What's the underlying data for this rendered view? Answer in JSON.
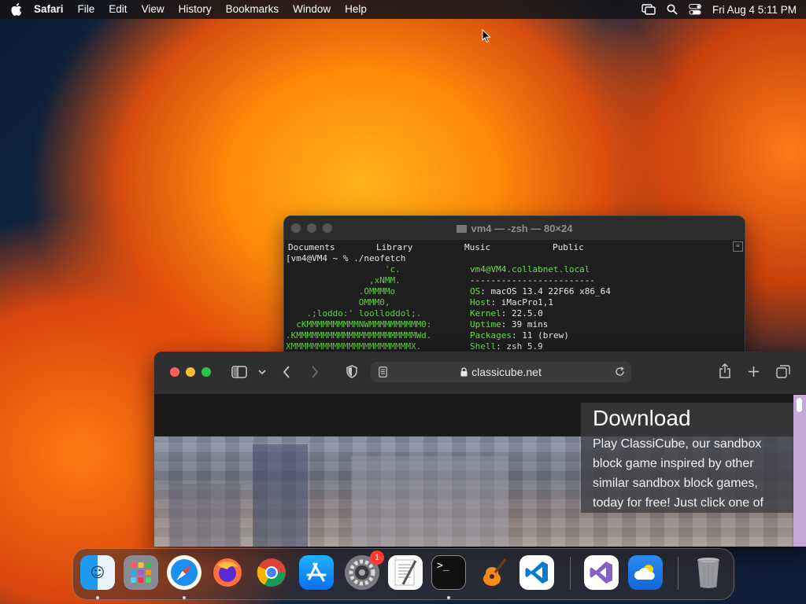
{
  "menubar": {
    "app_name": "Safari",
    "items": [
      "File",
      "Edit",
      "View",
      "History",
      "Bookmarks",
      "Window",
      "Help"
    ],
    "clock": "Fri Aug 4  5:11 PM"
  },
  "terminal": {
    "title": "vm4 — -zsh — 80×24",
    "dirs": [
      "Documents",
      "Library",
      "Music",
      "Public"
    ],
    "prompt": "vm4@VM4 ~ % ./neofetch",
    "logo_lines": [
      "                   'c.",
      "                ,xNMM.",
      "              .OMMMMo",
      "              OMMM0,",
      "    .;loddo:' loolloddol;.",
      "  cKMMMMMMMMMMNWMMMMMMMMMM0:",
      ".KMMMMMMMMMMMMMMMMMMMMMMMWd.",
      "XMMMMMMMMMMMMMMMMMMMMMMMX."
    ],
    "user_host": "vm4@VM4.collabnet.local",
    "separator": "------------------------",
    "info": [
      {
        "key": "OS",
        "value": "macOS 13.4 22F66 x86_64"
      },
      {
        "key": "Host",
        "value": "iMacPro1,1"
      },
      {
        "key": "Kernel",
        "value": "22.5.0"
      },
      {
        "key": "Uptime",
        "value": "39 mins"
      },
      {
        "key": "Packages",
        "value": "11 (brew)"
      },
      {
        "key": "Shell",
        "value": "zsh 5.9"
      }
    ]
  },
  "safari": {
    "url": "classicube.net",
    "panel_title": "Download",
    "panel_text": "Play ClassiCube, our sandbox block game inspired by other similar sandbox block games, today for free! Just click one of"
  },
  "dock": {
    "apps": [
      {
        "name": "Finder",
        "icon": "finder-icon",
        "running": true
      },
      {
        "name": "Launchpad",
        "icon": "launchpad-icon",
        "running": false
      },
      {
        "name": "Safari",
        "icon": "safari-icon",
        "running": true
      },
      {
        "name": "Firefox",
        "icon": "firefox-icon",
        "running": false
      },
      {
        "name": "Chrome",
        "icon": "chrome-icon",
        "running": false
      },
      {
        "name": "App Store",
        "icon": "app-store-icon",
        "running": false
      },
      {
        "name": "System Settings",
        "icon": "settings-icon",
        "running": false,
        "badge": "1"
      },
      {
        "name": "TextEdit",
        "icon": "textedit-icon",
        "running": false
      },
      {
        "name": "Terminal",
        "icon": "terminal-icon",
        "running": true
      },
      {
        "name": "GarageBand",
        "icon": "garageband-icon",
        "running": false
      },
      {
        "name": "Visual Studio Code",
        "icon": "vscode-icon",
        "running": false
      },
      {
        "name": "Visual Studio",
        "icon": "visual-studio-icon",
        "running": false
      },
      {
        "name": "Weather",
        "icon": "weather-icon",
        "running": false
      },
      {
        "name": "Trash",
        "icon": "trash-icon",
        "running": false
      }
    ]
  }
}
